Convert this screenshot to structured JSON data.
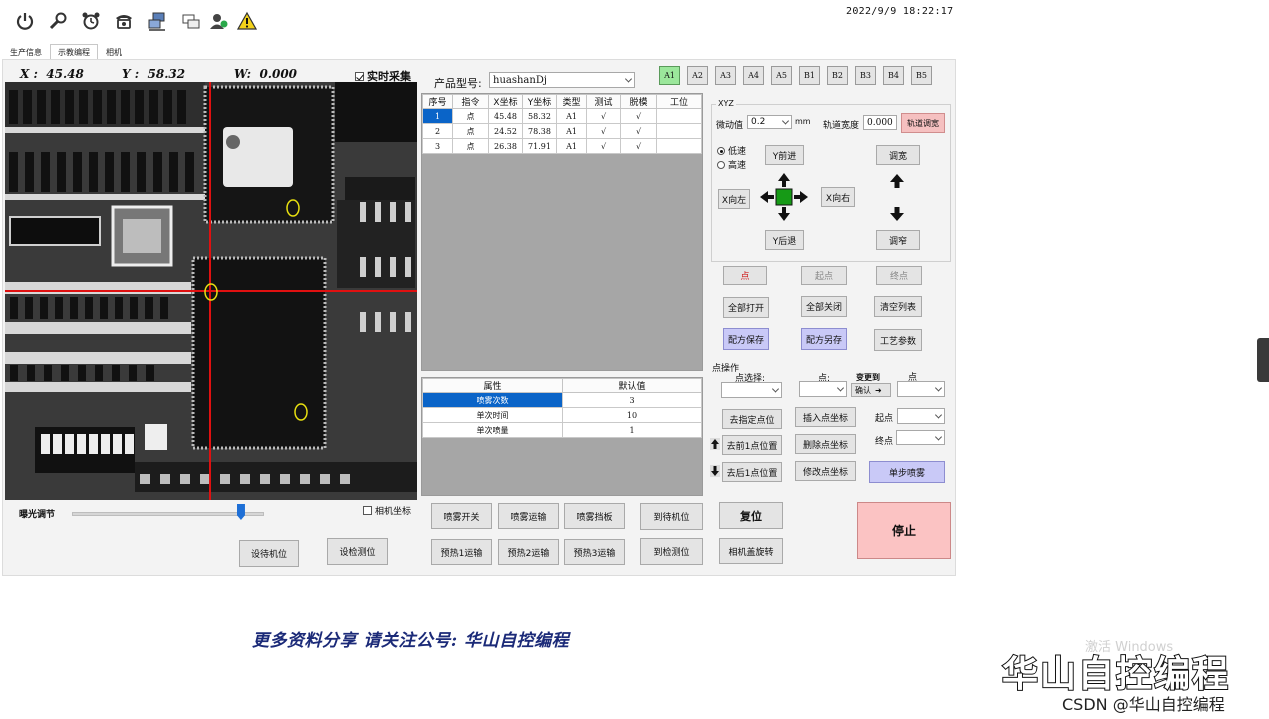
{
  "datetime": "2022/9/9  18:22:17",
  "toolbar_icons": [
    "power-icon",
    "wrench-icon",
    "alarm-clock-icon",
    "telephone-icon",
    "network-icon",
    "windows-icon",
    "user-icon",
    "warning-icon"
  ],
  "tabs": [
    "生产信息",
    "示教编程",
    "相机"
  ],
  "active_tab": 1,
  "coords": {
    "x_label": "X :",
    "x": "45.48",
    "y_label": "Y :",
    "y": "58.32",
    "w_label": "W:",
    "w": "0.000"
  },
  "realtime": "实时采集",
  "product": {
    "label": "产品型号:",
    "value": "huashanDj"
  },
  "positions": [
    "A1",
    "A2",
    "A3",
    "A4",
    "A5",
    "B1",
    "B2",
    "B3",
    "B4",
    "B5"
  ],
  "points_table": {
    "headers": [
      "序号",
      "指令",
      "X坐标",
      "Y坐标",
      "类型",
      "测试",
      "脱模",
      "工位"
    ],
    "rows": [
      [
        "1",
        "点",
        "45.48",
        "58.32",
        "A1",
        "√",
        "√",
        ""
      ],
      [
        "2",
        "点",
        "24.52",
        "78.38",
        "A1",
        "√",
        "√",
        ""
      ],
      [
        "3",
        "点",
        "26.38",
        "71.91",
        "A1",
        "√",
        "√",
        ""
      ]
    ]
  },
  "props_table": {
    "headers": [
      "属性",
      "默认值"
    ],
    "rows": [
      [
        "喷雾次数",
        "3"
      ],
      [
        "单次时间",
        "10"
      ],
      [
        "单次喷量",
        "1"
      ]
    ]
  },
  "xyz": {
    "title": "XYZ",
    "jog_label": "微动值",
    "jog_value": "0.2",
    "jog_unit": "mm",
    "track_label": "轨道宽度",
    "track_value": "0.000",
    "track_button": "轨道调宽",
    "speed_low": "低速",
    "speed_high": "高速",
    "y_forward": "Y前进",
    "y_back": "Y后退",
    "x_left": "X向左",
    "x_right": "X向右",
    "widen": "调宽",
    "narrow": "调窄",
    "point": "点",
    "start": "起点",
    "end": "终点"
  },
  "action_buttons": [
    "全部打开",
    "全部关闭",
    "清空列表",
    "配方保存",
    "配方另存",
    "工艺参数"
  ],
  "point_ops": {
    "title": "点操作",
    "select_label": "点选择:",
    "point_label": "点:",
    "change_label": "变更到",
    "point_label2": "点",
    "confirm": "确认",
    "goto": "去指定点位",
    "insert": "插入点坐标",
    "start_label": "起点",
    "prev": "去前1点位置",
    "delete": "删除点坐标",
    "end_label": "终点",
    "next": "去后1点位置",
    "modify": "修改点坐标",
    "step_spray": "单步喷雾"
  },
  "exposure_label": "曝光调节",
  "exposure_level": 0.88,
  "camera_coord": "相机坐标",
  "set_wait": "设待机位",
  "set_detect": "设检测位",
  "bottom_buttons": {
    "spray_switch": "喷雾开关",
    "spray_transport": "喷雾运输",
    "spray_baffle": "喷雾挡板",
    "to_wait": "到待机位",
    "reset": "复位",
    "preheat1": "预热1运输",
    "preheat2": "预热2运输",
    "preheat3": "预热3运输",
    "to_detect": "到检测位",
    "camera_rotate": "相机盖旋转",
    "stop": "停止"
  },
  "footer": "更多资料分享  请关注公号: 华山自控编程",
  "activate_windows": "激活 Windows",
  "watermark_big": "华山自控编程",
  "watermark_small": "CSDN @华山自控编程",
  "colors": {
    "active_position": "#9be79b",
    "selected_row": "#0a64c8",
    "purple_button": "#c9c9f7",
    "crosshair": "#e01010",
    "stop_button": "#fbc3c3"
  }
}
